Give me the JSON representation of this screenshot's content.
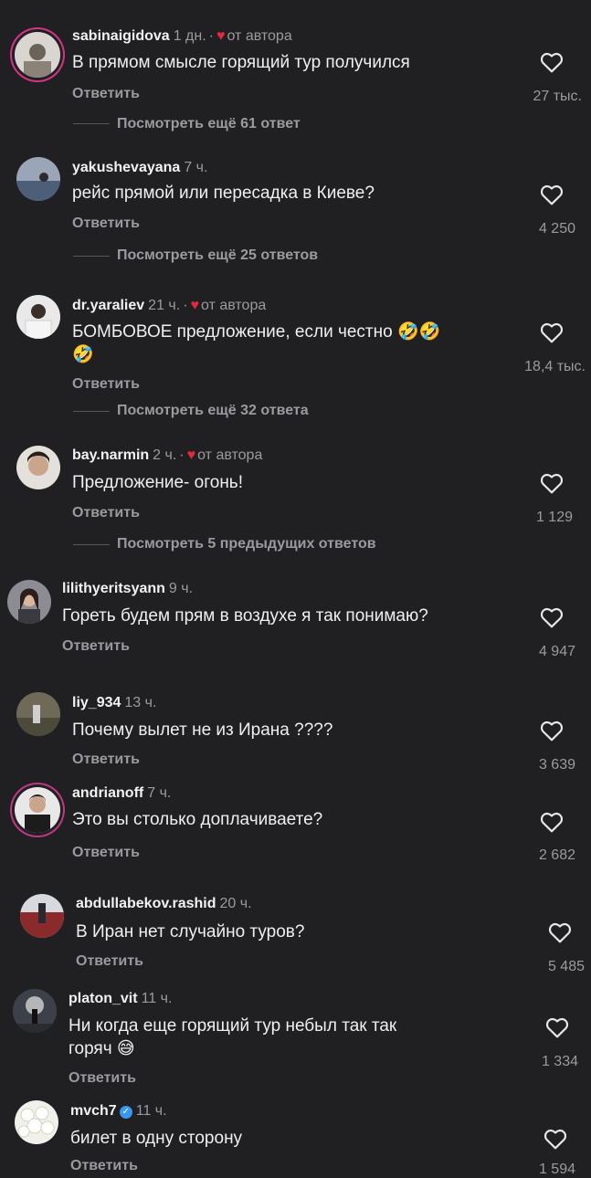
{
  "comments": [
    {
      "user": "sabinaigidova",
      "time": "1 дн.",
      "author_liked": true,
      "author_text": "от автора",
      "text": "В прямом смысле горящий тур получился",
      "reply": "Ответить",
      "likes": "27 тыс.",
      "more": "Посмотреть ещё 61 ответ"
    },
    {
      "user": "yakushevayana",
      "time": "7 ч.",
      "text": "рейс прямой или пересадка в Киеве?",
      "reply": "Ответить",
      "likes": "4 250",
      "more": "Посмотреть ещё 25 ответов"
    },
    {
      "user": "dr.yaraliev",
      "time": "21 ч.",
      "author_liked": true,
      "author_text": "от автора",
      "text": "БОМБОВОЕ предложение, если честно 🤣🤣",
      "text2": "🤣",
      "reply": "Ответить",
      "likes": "18,4 тыс.",
      "more": "Посмотреть ещё 32 ответа"
    },
    {
      "user": "bay.narmin",
      "time": "2 ч.",
      "author_liked": true,
      "author_text": "от автора",
      "text": "Предложение- огонь!",
      "reply": "Ответить",
      "likes": "1 129",
      "more": "Посмотреть 5 предыдущих ответов"
    },
    {
      "user": "lilithyeritsyann",
      "time": "9 ч.",
      "text": "Гореть будем прям в воздухе я так понимаю?",
      "reply": "Ответить",
      "likes": "4 947"
    },
    {
      "user": "liy_934",
      "time": "13 ч.",
      "text": "Почему вылет не из Ирана ????",
      "reply": "Ответить",
      "likes": "3 639"
    },
    {
      "user": "andrianoff",
      "time": "7 ч.",
      "text": "Это вы столько доплачиваете?",
      "reply": "Ответить",
      "likes": "2 682"
    },
    {
      "user": "abdullabekov.rashid",
      "time": "20 ч.",
      "text": "В Иран нет случайно туров?",
      "reply": "Ответить",
      "likes": "5 485"
    },
    {
      "user": "platon_vit",
      "time": "11 ч.",
      "text": "Ни когда еще горящий тур небыл  так так",
      "text2": "горяч 😅",
      "reply": "Ответить",
      "likes": "1 334"
    },
    {
      "user": "mvch7",
      "time": "11 ч.",
      "verified": true,
      "text": "билет в одну сторону",
      "reply": "Ответить",
      "likes": "1 594"
    }
  ],
  "colors": {
    "background": "#202023",
    "author_heart": "#e6283c",
    "verified": "#3897f0"
  }
}
